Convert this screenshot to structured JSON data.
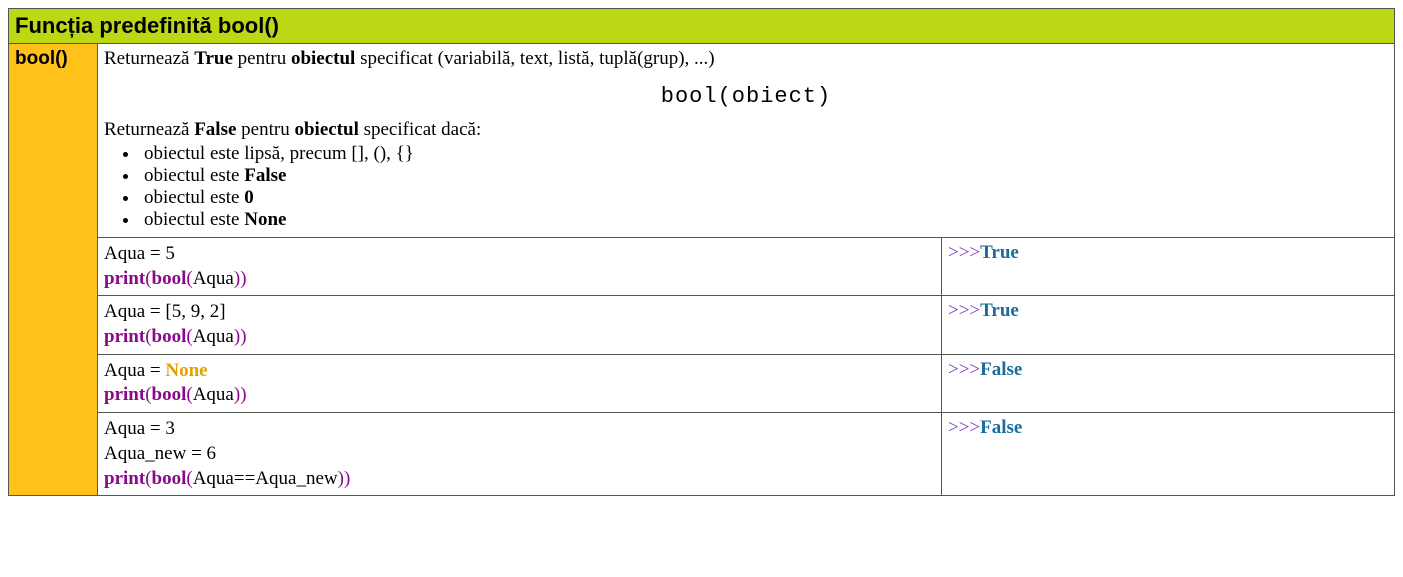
{
  "title": "Funcția predefinită bool()",
  "side_label": "bool()",
  "desc": {
    "true_prefix": "Returnează ",
    "true_value": "True",
    "true_mid": " pentru ",
    "true_obj": "obiectul",
    "true_suffix": " specificat (variabilă, text, listă, tuplă(grup), ...)",
    "syntax": "bool(obiect)",
    "false_prefix": "Returnează ",
    "false_value": "False",
    "false_mid": " pentru ",
    "false_obj": "obiectul",
    "false_suffix": " specificat dacă:",
    "bullets": [
      {
        "pre": "obiectul este lipsă, precum [], (), {}",
        "bold": ""
      },
      {
        "pre": "obiectul este ",
        "bold": "False"
      },
      {
        "pre": "obiectul este ",
        "bold": "0"
      },
      {
        "pre": "obiectul este ",
        "bold": "None"
      }
    ]
  },
  "rows": [
    {
      "assigns": [
        {
          "lhs": "Aqua",
          "eq": " = ",
          "rhs": "5",
          "rhs_style": ""
        }
      ],
      "call_inner": "Aqua",
      "prompt": ">>>",
      "out": "True"
    },
    {
      "assigns": [
        {
          "lhs": "Aqua",
          "eq": " = ",
          "rhs": "[5, 9, 2]",
          "rhs_style": ""
        }
      ],
      "call_inner": "Aqua",
      "prompt": ">>>",
      "out": "True"
    },
    {
      "assigns": [
        {
          "lhs": "Aqua",
          "eq": " = ",
          "rhs": "None",
          "rhs_style": "orange"
        }
      ],
      "call_inner": "Aqua",
      "prompt": ">>>",
      "out": "False"
    },
    {
      "assigns": [
        {
          "lhs": "Aqua",
          "eq": " = ",
          "rhs": "3",
          "rhs_style": ""
        },
        {
          "lhs": "Aqua_new",
          "eq": " = ",
          "rhs": "6",
          "rhs_style": ""
        }
      ],
      "call_inner": "Aqua==Aqua_new",
      "prompt": ">>>",
      "out": "False"
    }
  ]
}
